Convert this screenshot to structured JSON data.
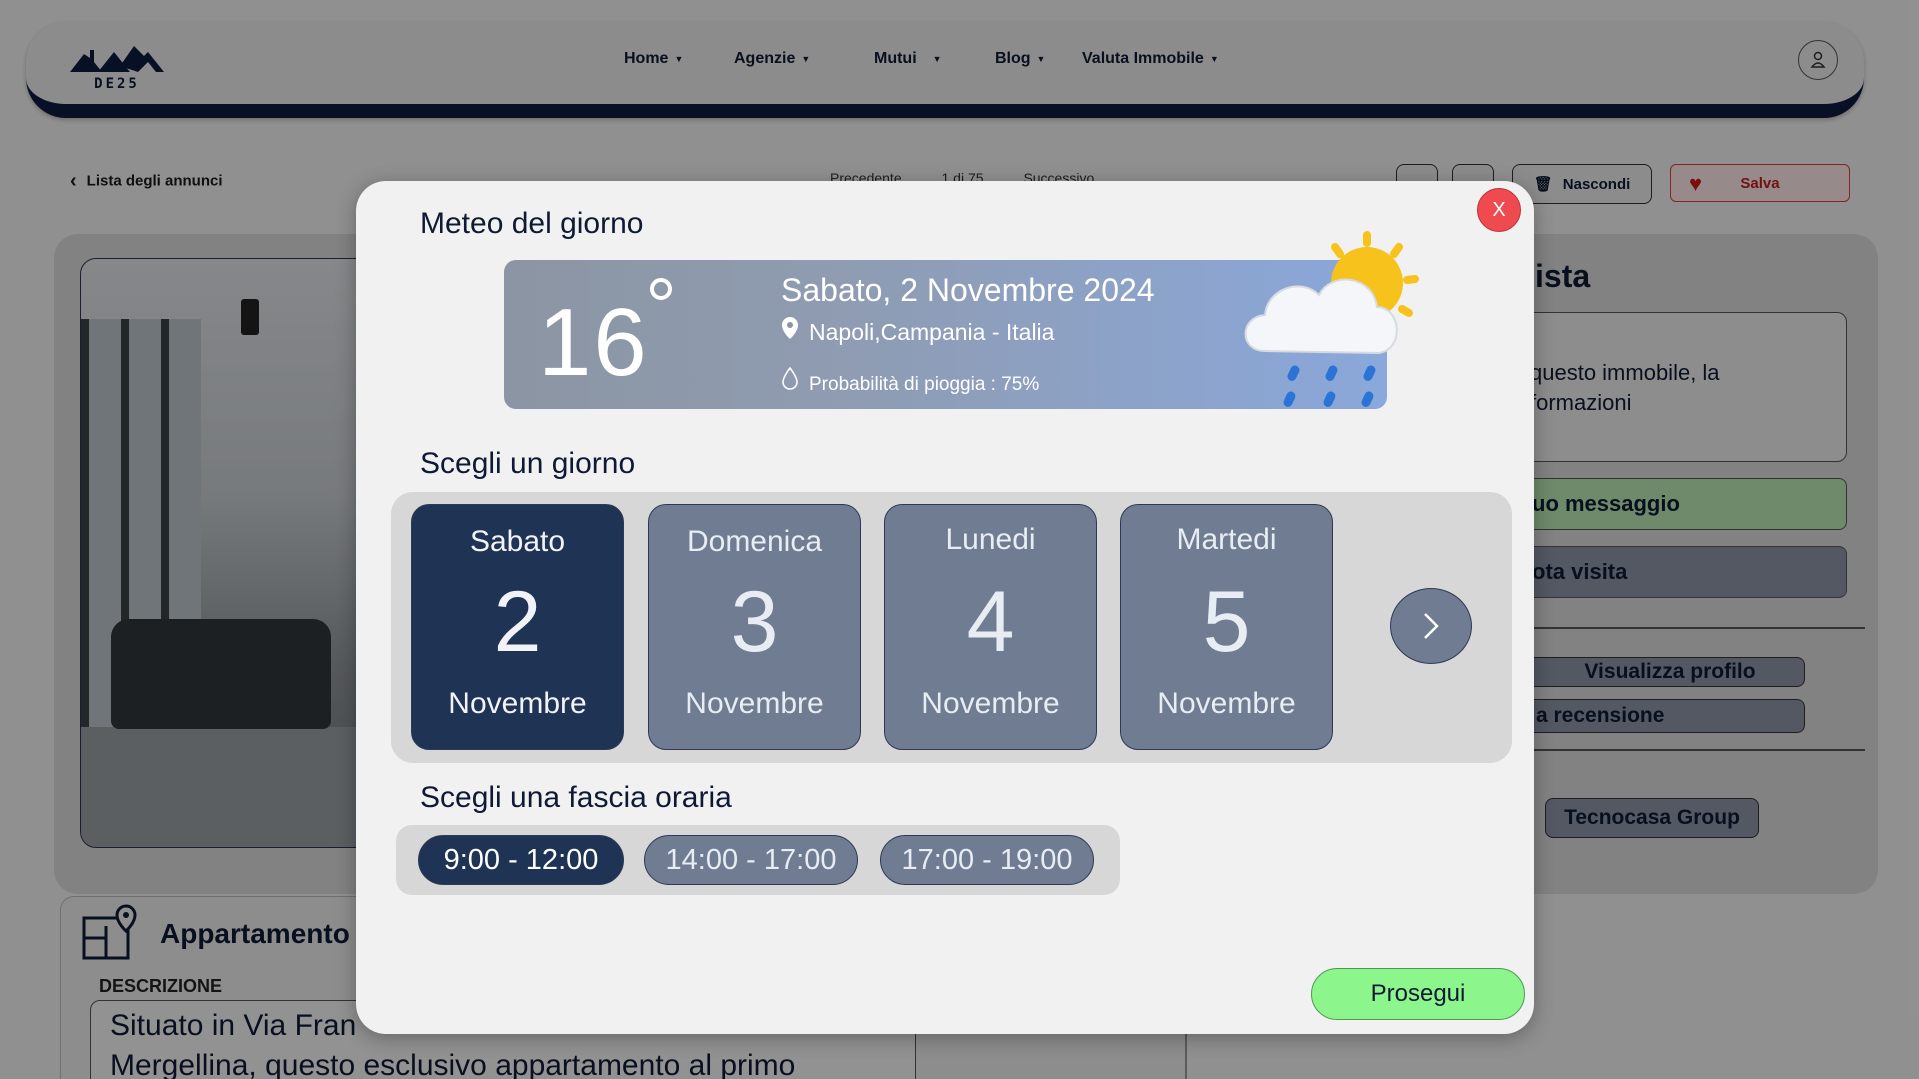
{
  "navbar": {
    "logo_text": "DE25",
    "items": [
      {
        "label": "Home"
      },
      {
        "label": "Agenzie"
      },
      {
        "label": "Mutui"
      },
      {
        "label": "Blog"
      },
      {
        "label": "Valuta Immobile"
      }
    ]
  },
  "listing_toolbar": {
    "back_label": "Lista degli annunci",
    "prev_label": "Precedente",
    "page_counter": "1 di 75",
    "next_label": "Successivo",
    "hide_label": "Nascondi",
    "save_label": "Salva"
  },
  "contact_panel": {
    "title_fragment": "ista",
    "text_line1": "questo immobile, la",
    "text_line2": "formazioni",
    "message_button": "uo messaggio",
    "visit_button": "ota visita",
    "profile_button": "Visualizza profilo",
    "review_button": "a recensione",
    "agency": "Tecnocasa Group"
  },
  "listing": {
    "title_fragment": "Appartamento V",
    "description_label": "DESCRIZIONE",
    "description_line1": "Situato in Via Fran",
    "description_line2": "Mergellina, questo esclusivo appartamento al primo"
  },
  "modal": {
    "close_label": "X",
    "weather_title": "Meteo del giorno",
    "weather": {
      "temperature": "16",
      "date": "Sabato, 2 Novembre 2024",
      "location": "Napoli,Campania - Italia",
      "rain_probability": "Probabilità di pioggia : 75%"
    },
    "day_title": "Scegli un giorno",
    "days": [
      {
        "name": "Sabato",
        "number": "2",
        "month": "Novembre",
        "selected": true
      },
      {
        "name": "Domenica",
        "number": "3",
        "month": "Novembre",
        "selected": false
      },
      {
        "name": "Lunedi",
        "number": "4",
        "month": "Novembre",
        "selected": false
      },
      {
        "name": "Martedi",
        "number": "5",
        "month": "Novembre",
        "selected": false
      }
    ],
    "slot_title": "Scegli una fascia oraria",
    "slots": [
      {
        "label": "9:00 - 12:00",
        "selected": true
      },
      {
        "label": "14:00 - 17:00",
        "selected": false
      },
      {
        "label": "17:00 - 19:00",
        "selected": false
      }
    ],
    "continue_label": "Prosegui"
  },
  "icons": {
    "next": "chevron-right-icon",
    "user": "user-icon",
    "heart": "heart-icon",
    "pin": "location-pin-icon",
    "drop": "rain-drop-icon",
    "weather": "cloud-sun-rain-icon"
  },
  "colors": {
    "brand_navy": "#0d1b3d",
    "selected_card": "#1f3355",
    "unselected_card": "#6f7c92",
    "continue_green": "#8cf58c",
    "close_red": "#ef4a4f",
    "save_red": "#d01818"
  }
}
